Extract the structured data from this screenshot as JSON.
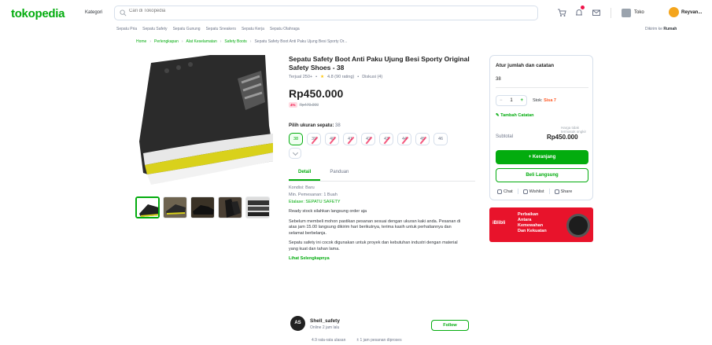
{
  "header": {
    "logo": "tokopedia",
    "kategori": "Kategori",
    "search_placeholder": "Cari di Tokopedia",
    "toko_label": "Toko",
    "user_name": "Reyvan..."
  },
  "quicklinks": [
    "Sepatu Pria",
    "Sepatu Safety",
    "Sepatu Gunung",
    "Sepatu Sneakers",
    "Sepatu Kerja",
    "Sepatu Olahraga"
  ],
  "location": {
    "prefix": "Dikirim ke",
    "value": "Rumah"
  },
  "breadcrumb": [
    "Home",
    "Perlengkapan",
    "Alat Keselamatan",
    "Safety Boots",
    "Sepatu Safety Boot Anti Paku Ujung Besi Sporty Or..."
  ],
  "product": {
    "title": "Sepatu Safety Boot Anti Paku Ujung Besi Sporty Original Safety Shoes - 38",
    "sold": "Terjual 250+",
    "rating": "4.8 (90 rating)",
    "discussion": "Diskusi (4)",
    "price": "Rp450.000",
    "discount": "4%",
    "original_price": "Rp470.000",
    "size_label": "Pilih ukuran sepatu:",
    "size_selected": "38",
    "sizes": [
      "38",
      "39",
      "40",
      "41",
      "42",
      "43",
      "44",
      "45",
      "46"
    ],
    "tabs": [
      "Detail",
      "Panduan"
    ],
    "details": [
      "Kondisi: Baru",
      "Min. Pemesanan: 1 Buah",
      "Etalase: SEPATU SAFETY"
    ],
    "desc": [
      "Ready stock silahkan langsung order aja",
      "Sebelum membeli mohon pastikan pesanan sesuai dengan ukuran kaki anda. Pesanan di atas jam 15.00 langsung dikirim hari berikutnya, terima kasih untuk perhatiannya dan selamat berbelanja.",
      "Sepatu safety ini cocok digunakan untuk proyek dan kebutuhan industri dengan material yang kuat dan tahan lama."
    ],
    "more": "Lihat Selengkapnya"
  },
  "shop": {
    "initials": "AS",
    "name": "Shell_safety",
    "status": "Online 2 jam lalu",
    "follow": "Follow",
    "stats": [
      "4.9 rata-rata ulasan",
      "± 1 jam pesanan diproses"
    ]
  },
  "card": {
    "title": "Atur jumlah dan catatan",
    "size": "38",
    "qty": "1",
    "stock_prefix": "Stok:",
    "stock_value": "Sisa 7",
    "note": "Tambah Catatan",
    "hint": "Harga tidak termasuk ongkir",
    "subtotal_label": "Subtotal",
    "subtotal": "Rp450.000",
    "buy": "+ Keranjang",
    "buy_now": "Beli Langsung",
    "actions": [
      "Chat",
      "Wishlist",
      "Share"
    ]
  },
  "banner": {
    "brand": "iBlibli",
    "lines": [
      "Perbaikan",
      "Antara",
      "Kemewahan",
      "Dan Kekuatan"
    ]
  },
  "colors": {
    "brand": "#03ac0e",
    "price_discount": "#ef144a",
    "banner": "#e8132b"
  }
}
